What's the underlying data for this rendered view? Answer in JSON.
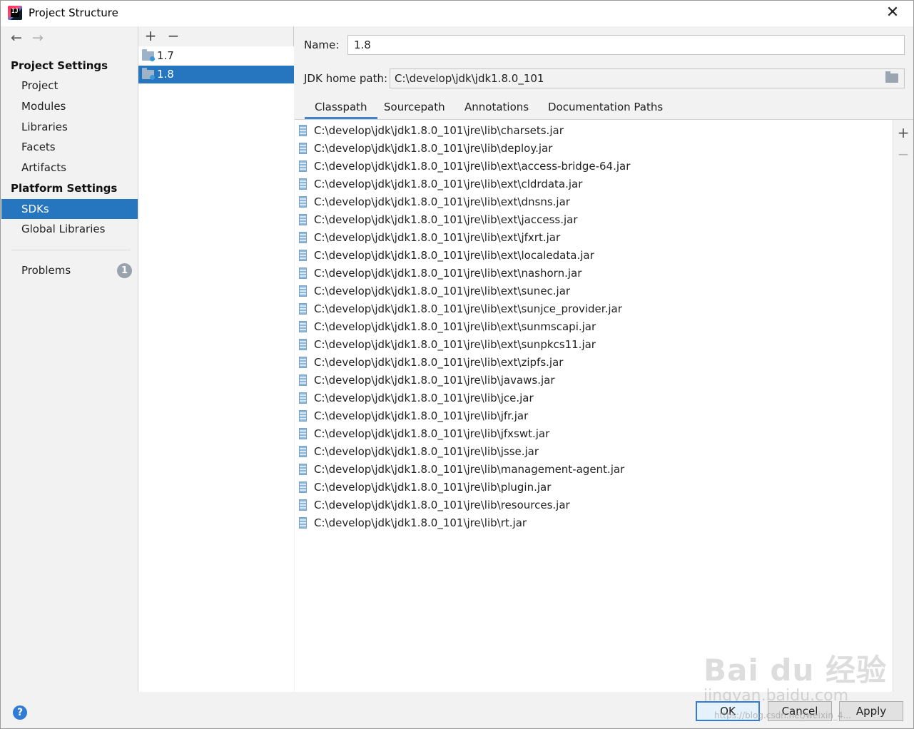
{
  "window": {
    "title": "Project Structure",
    "close_glyph": "✕"
  },
  "nav": {
    "back_glyph": "←",
    "forward_glyph": "→",
    "project_settings_header": "Project Settings",
    "project_settings_items": [
      "Project",
      "Modules",
      "Libraries",
      "Facets",
      "Artifacts"
    ],
    "platform_settings_header": "Platform Settings",
    "platform_settings_items": [
      "SDKs",
      "Global Libraries"
    ],
    "selected_item": "SDKs",
    "problems_label": "Problems",
    "problems_count": "1"
  },
  "sdk_panel": {
    "add_glyph": "+",
    "remove_glyph": "−",
    "items": [
      "1.7",
      "1.8"
    ],
    "selected": "1.8"
  },
  "detail": {
    "name_label": "Name:",
    "name_value": "1.8",
    "jdk_home_label": "JDK home path:",
    "jdk_home_value": "C:\\develop\\jdk\\jdk1.8.0_101",
    "tabs": [
      "Classpath",
      "Sourcepath",
      "Annotations",
      "Documentation Paths"
    ],
    "active_tab": "Classpath",
    "classpath_entries": [
      "C:\\develop\\jdk\\jdk1.8.0_101\\jre\\lib\\charsets.jar",
      "C:\\develop\\jdk\\jdk1.8.0_101\\jre\\lib\\deploy.jar",
      "C:\\develop\\jdk\\jdk1.8.0_101\\jre\\lib\\ext\\access-bridge-64.jar",
      "C:\\develop\\jdk\\jdk1.8.0_101\\jre\\lib\\ext\\cldrdata.jar",
      "C:\\develop\\jdk\\jdk1.8.0_101\\jre\\lib\\ext\\dnsns.jar",
      "C:\\develop\\jdk\\jdk1.8.0_101\\jre\\lib\\ext\\jaccess.jar",
      "C:\\develop\\jdk\\jdk1.8.0_101\\jre\\lib\\ext\\jfxrt.jar",
      "C:\\develop\\jdk\\jdk1.8.0_101\\jre\\lib\\ext\\localedata.jar",
      "C:\\develop\\jdk\\jdk1.8.0_101\\jre\\lib\\ext\\nashorn.jar",
      "C:\\develop\\jdk\\jdk1.8.0_101\\jre\\lib\\ext\\sunec.jar",
      "C:\\develop\\jdk\\jdk1.8.0_101\\jre\\lib\\ext\\sunjce_provider.jar",
      "C:\\develop\\jdk\\jdk1.8.0_101\\jre\\lib\\ext\\sunmscapi.jar",
      "C:\\develop\\jdk\\jdk1.8.0_101\\jre\\lib\\ext\\sunpkcs11.jar",
      "C:\\develop\\jdk\\jdk1.8.0_101\\jre\\lib\\ext\\zipfs.jar",
      "C:\\develop\\jdk\\jdk1.8.0_101\\jre\\lib\\javaws.jar",
      "C:\\develop\\jdk\\jdk1.8.0_101\\jre\\lib\\jce.jar",
      "C:\\develop\\jdk\\jdk1.8.0_101\\jre\\lib\\jfr.jar",
      "C:\\develop\\jdk\\jdk1.8.0_101\\jre\\lib\\jfxswt.jar",
      "C:\\develop\\jdk\\jdk1.8.0_101\\jre\\lib\\jsse.jar",
      "C:\\develop\\jdk\\jdk1.8.0_101\\jre\\lib\\management-agent.jar",
      "C:\\develop\\jdk\\jdk1.8.0_101\\jre\\lib\\plugin.jar",
      "C:\\develop\\jdk\\jdk1.8.0_101\\jre\\lib\\resources.jar",
      "C:\\develop\\jdk\\jdk1.8.0_101\\jre\\lib\\rt.jar"
    ],
    "side_add_glyph": "+",
    "side_remove_glyph": "−"
  },
  "footer": {
    "help_glyph": "?",
    "ok_label": "OK",
    "cancel_label": "Cancel",
    "apply_label": "Apply"
  },
  "watermark": {
    "brand": "Bai du 经验",
    "domain": "jingyan.baidu.com",
    "url": "https://blog.csdn.net/weixin_4..."
  },
  "colors": {
    "selection": "#2675bf",
    "tab_underline": "#4083c9",
    "help_blue": "#2f7bd6",
    "badge_gray": "#9aa3ad"
  },
  "icons": {
    "sdk_item": "jdk-folder-icon",
    "classpath_entry": "jar-archive-icon",
    "browse": "folder-open-icon"
  }
}
